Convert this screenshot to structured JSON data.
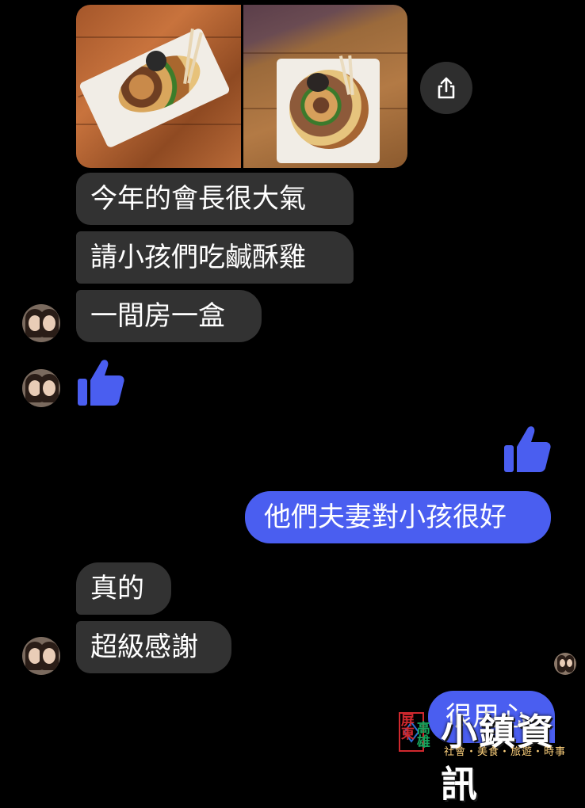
{
  "icons": {
    "share": "share-icon",
    "like": "thumbs-up-icon"
  },
  "colors": {
    "background": "#000000",
    "incoming_bubble": "#323232",
    "outgoing_bubble": "#4a5ef0",
    "like": "#4a5ef0"
  },
  "messages": [
    {
      "from": "other",
      "text": "今年的會長很大氣"
    },
    {
      "from": "other",
      "text": "請小孩們吃鹹酥雞"
    },
    {
      "from": "other",
      "text": "一間房一盒"
    },
    {
      "from": "me",
      "text": "他們夫妻對小孩很好"
    },
    {
      "from": "other",
      "text": "真的"
    },
    {
      "from": "other",
      "text": "超級感謝"
    },
    {
      "from": "me",
      "text": "很用心"
    }
  ],
  "watermark": {
    "region_1": "屏東",
    "region_2": "高雄",
    "title": "小鎮資訊",
    "subtitle": "社會・美食・旅遊・時事"
  }
}
